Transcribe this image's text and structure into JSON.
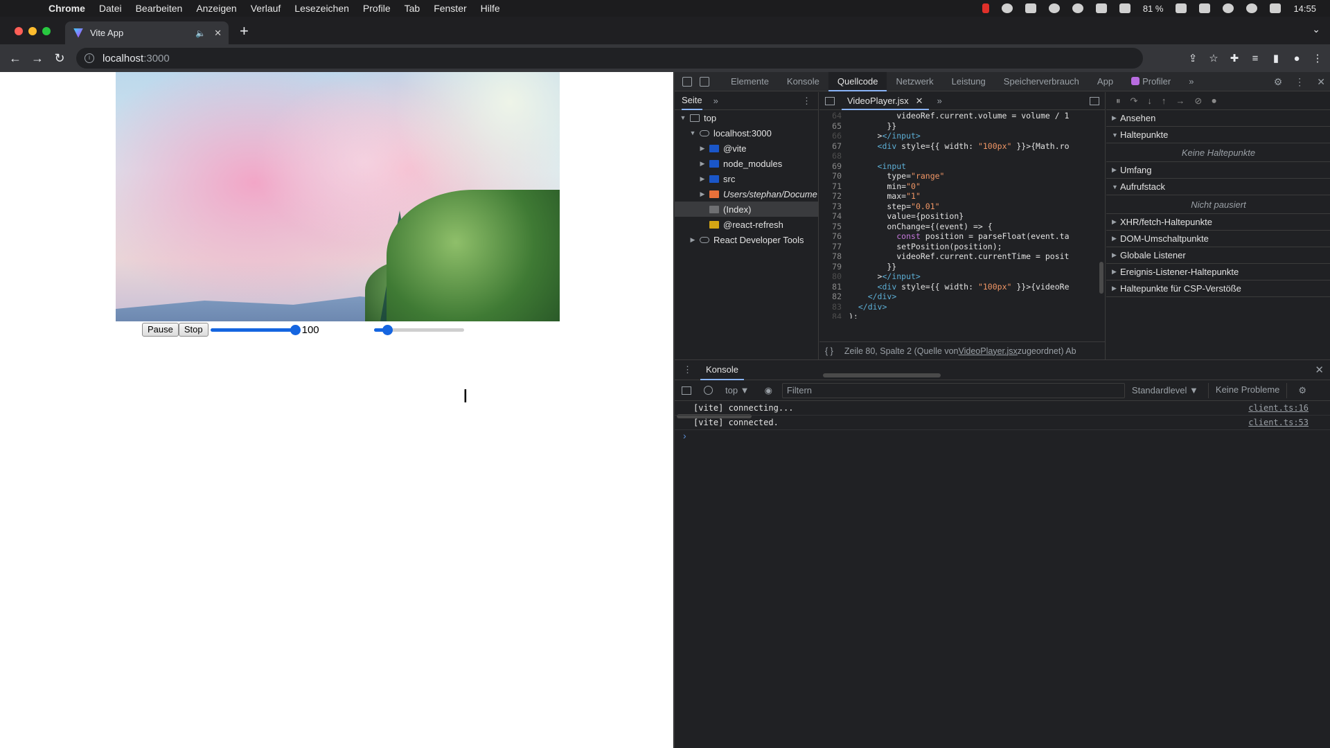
{
  "menubar": {
    "items": [
      "Chrome",
      "Datei",
      "Bearbeiten",
      "Anzeigen",
      "Verlauf",
      "Lesezeichen",
      "Profile",
      "Tab",
      "Fenster",
      "Hilfe"
    ],
    "battery": "81 %",
    "time": "14:55"
  },
  "browser": {
    "tab_title": "Vite App",
    "url_host": "localhost",
    "url_port": ":3000"
  },
  "page": {
    "pause_label": "Pause",
    "stop_label": "Stop",
    "volume_value": "100",
    "volume_level": 1.0,
    "position_level": 0.1
  },
  "devtools": {
    "tabs": [
      "Elemente",
      "Konsole",
      "Quellcode",
      "Netzwerk",
      "Leistung",
      "Speicherverbrauch",
      "App",
      "Profiler"
    ],
    "active_tab": "Quellcode",
    "navigator_tab": "Seite",
    "tree": [
      {
        "label": "top",
        "depth": 0,
        "arrow": "▼",
        "icon": "frame"
      },
      {
        "label": "localhost:3000",
        "depth": 1,
        "arrow": "▼",
        "icon": "cloud"
      },
      {
        "label": "@vite",
        "depth": 2,
        "arrow": "▶",
        "icon": "blue"
      },
      {
        "label": "node_modules",
        "depth": 2,
        "arrow": "▶",
        "icon": "blue"
      },
      {
        "label": "src",
        "depth": 2,
        "arrow": "▶",
        "icon": "blue"
      },
      {
        "label": "Users/stephan/Docume",
        "depth": 2,
        "arrow": "▶",
        "icon": "orange",
        "italic": true
      },
      {
        "label": "(Index)",
        "depth": 2,
        "arrow": "",
        "icon": "gray",
        "selected": true
      },
      {
        "label": "@react-refresh",
        "depth": 2,
        "arrow": "",
        "icon": "yellow"
      },
      {
        "label": "React Developer Tools",
        "depth": 1,
        "arrow": "▶",
        "icon": "cloud"
      }
    ],
    "editor_file": "VideoPlayer.jsx",
    "code_lines": [
      {
        "n": "64",
        "dim": true,
        "html": "<span class='ct'>          videoRef.current.volume = volume / 1</span>"
      },
      {
        "n": "65",
        "html": "<span class='ct'>        }}</span>"
      },
      {
        "n": "66",
        "dim": true,
        "html": "<span class='ct'>      &gt;</span><span class='tag'>&lt;/input&gt;</span>"
      },
      {
        "n": "67",
        "html": "<span class='ct'>      </span><span class='tag'>&lt;div</span><span class='ct'> style={{ width: </span><span class='str'>\"100px\"</span><span class='ct'> }}&gt;{Math.ro</span>"
      },
      {
        "n": "68",
        "dim": true,
        "html": ""
      },
      {
        "n": "69",
        "html": "<span class='ct'>      </span><span class='tag'>&lt;input</span>"
      },
      {
        "n": "70",
        "html": "<span class='ct'>        type=</span><span class='str'>\"range\"</span>"
      },
      {
        "n": "71",
        "html": "<span class='ct'>        min=</span><span class='str'>\"0\"</span>"
      },
      {
        "n": "72",
        "html": "<span class='ct'>        max=</span><span class='str'>\"1\"</span>"
      },
      {
        "n": "73",
        "html": "<span class='ct'>        step=</span><span class='str'>\"0.01\"</span>"
      },
      {
        "n": "74",
        "html": "<span class='ct'>        value={position}</span>"
      },
      {
        "n": "75",
        "html": "<span class='ct'>        onChange={(event) =&gt; {</span>"
      },
      {
        "n": "76",
        "html": "<span class='ct'>          </span><span class='kw'>const</span><span class='ct'> position = parseFloat(event.ta</span>"
      },
      {
        "n": "77",
        "html": "<span class='ct'>          setPosition(position);</span>"
      },
      {
        "n": "78",
        "html": "<span class='ct'>          videoRef.current.currentTime = posit</span>"
      },
      {
        "n": "79",
        "html": "<span class='ct'>        }}</span>"
      },
      {
        "n": "80",
        "dim": true,
        "html": "<span class='ct'>      &gt;</span><span class='tag'>&lt;/input&gt;</span>"
      },
      {
        "n": "81",
        "html": "<span class='ct'>      </span><span class='tag'>&lt;div</span><span class='ct'> style={{ width: </span><span class='str'>\"100px\"</span><span class='ct'> }}&gt;{videoRe</span>"
      },
      {
        "n": "82",
        "html": "<span class='ct'>    </span><span class='tag'>&lt;/div&gt;</span>"
      },
      {
        "n": "83",
        "dim": true,
        "html": "<span class='ct'>  </span><span class='tag'>&lt;/div&gt;</span>"
      },
      {
        "n": "84",
        "dim": true,
        "html": "<span class='ct'>);</span>"
      }
    ],
    "status_prefix": "Zeile 80, Spalte 2  (Quelle von ",
    "status_link": "VideoPlayer.jsx",
    "status_suffix": " zugeordnet)  Ab",
    "debugger_sections": [
      {
        "type": "sec",
        "label": "Ansehen",
        "arrow": "▶"
      },
      {
        "type": "sec",
        "label": "Haltepunkte",
        "arrow": "▼"
      },
      {
        "type": "empty",
        "label": "Keine Haltepunkte"
      },
      {
        "type": "sec",
        "label": "Umfang",
        "arrow": "▶"
      },
      {
        "type": "sec",
        "label": "Aufrufstack",
        "arrow": "▼"
      },
      {
        "type": "empty",
        "label": "Nicht pausiert"
      },
      {
        "type": "sec",
        "label": "XHR/fetch-Haltepunkte",
        "arrow": "▶"
      },
      {
        "type": "sec",
        "label": "DOM-Umschaltpunkte",
        "arrow": "▶"
      },
      {
        "type": "sec",
        "label": "Globale Listener",
        "arrow": "▶"
      },
      {
        "type": "sec",
        "label": "Ereignis-Listener-Haltepunkte",
        "arrow": "▶"
      },
      {
        "type": "sec",
        "label": "Haltepunkte für CSP-Verstöße",
        "arrow": "▶"
      }
    ],
    "console": {
      "tab": "Konsole",
      "context": "top ▼",
      "filter_placeholder": "Filtern",
      "level": "Standardlevel ▼",
      "problems": "Keine Probleme",
      "logs": [
        {
          "msg": "[vite] connecting...",
          "src": "client.ts:16"
        },
        {
          "msg": "[vite] connected.",
          "src": "client.ts:53"
        }
      ],
      "prompt": "›"
    }
  }
}
